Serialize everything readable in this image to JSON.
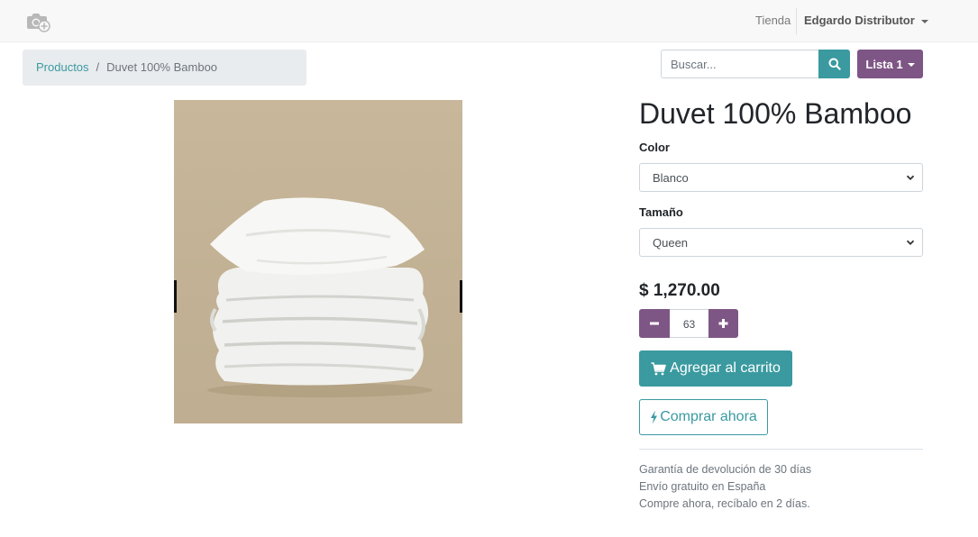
{
  "nav": {
    "logo_icon": "camera-plus-icon",
    "shop_label": "Tienda",
    "user_label": "Edgardo Distributor"
  },
  "breadcrumb": {
    "link": "Productos",
    "separator": "/",
    "current": "Duvet 100% Bamboo"
  },
  "search": {
    "placeholder": "Buscar..."
  },
  "pricelist": {
    "label": "Lista 1"
  },
  "product": {
    "title": "Duvet 100% Bamboo",
    "image_icon": "duvet-pillow-image",
    "color_label": "Color",
    "color_value": "Blanco",
    "size_label": "Tamaño",
    "size_value": "Queen",
    "price": "$ 1,270.00",
    "quantity": "63",
    "add_to_cart_label": "Agregar al carrito",
    "buy_now_label": "Comprar ahora"
  },
  "terms": [
    "Garantía de devolución de 30 días",
    "Envío gratuito en España",
    "Compre ahora, recíbalo en 2 días."
  ],
  "colors": {
    "primary": "#3a9aa0",
    "secondary": "#7e5685"
  }
}
